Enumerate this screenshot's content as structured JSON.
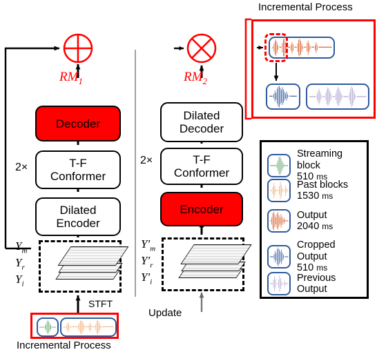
{
  "figure": {
    "left_branch": {
      "sum_operator": "plus-circle",
      "mask_label": "RM",
      "mask_sub": "1",
      "blocks": [
        {
          "id": "decoder",
          "label": "Decoder",
          "fill": "#FF0000"
        },
        {
          "id": "tf-conformer",
          "label": "T-F\nConformer",
          "fill": "#FFFFFF",
          "repeat": "2×"
        },
        {
          "id": "dilated-encoder",
          "label": "Dilated\nEncoder",
          "fill": "#FFFFFF"
        }
      ],
      "spectrogram_labels": [
        "Y_m",
        "Y_r",
        "Y_i"
      ],
      "spectrogram_labels_plain": [
        "Ym",
        "Yr",
        "Yi"
      ],
      "transform_label": "STFT",
      "caption": "Incremental Process"
    },
    "right_branch": {
      "product_operator": "times-circle",
      "mask_label": "RM",
      "mask_sub": "2",
      "blocks": [
        {
          "id": "dilated-decoder",
          "label": "Dilated\nDecoder",
          "fill": "#FFFFFF"
        },
        {
          "id": "tf-conformer-2",
          "label": "T-F\nConformer",
          "fill": "#FFFFFF",
          "repeat": "2×"
        },
        {
          "id": "encoder",
          "label": "Encoder",
          "fill": "#FF0000"
        }
      ],
      "spectrogram_labels": [
        "Y'_m",
        "Y'_r",
        "Y'_i"
      ],
      "spectrogram_labels_plain": [
        "Y'm",
        "Y'r",
        "Y'i"
      ],
      "caption": "Update"
    },
    "incremental_panel": {
      "title": "Incremental Process",
      "items": [
        {
          "name": "past-and-current-output",
          "color": "#D2541E"
        },
        {
          "name": "cropped-output",
          "color": "#2E5A9C"
        },
        {
          "name": "previous-output",
          "color": "#B3A4D4"
        }
      ]
    },
    "legend": {
      "entries": [
        {
          "icon": "waveform-streaming-block-icon",
          "color": "#4E9A5F",
          "name": "Streaming block",
          "duration": "510",
          "unit": "ms"
        },
        {
          "icon": "waveform-past-blocks-icon",
          "color": "#F0A870",
          "name": "Past blocks",
          "duration": "1530",
          "unit": "ms"
        },
        {
          "icon": "waveform-output-icon",
          "color": "#D2541E",
          "name": "Output",
          "duration": "2040",
          "unit": "ms"
        },
        {
          "icon": "waveform-cropped-output-icon",
          "color": "#2E5A9C",
          "name": "Cropped Output",
          "duration": "510",
          "unit": "ms"
        },
        {
          "icon": "waveform-previous-output-icon",
          "color": "#B3A4D4",
          "name": "Previous Output",
          "duration": "",
          "unit": ""
        }
      ]
    },
    "colors": {
      "accent_red": "#FF0000",
      "wave_green": "#4E9A5F",
      "wave_light_orange": "#F0A870",
      "wave_dark_orange": "#D2541E",
      "wave_blue": "#2E5A9C",
      "wave_purple": "#B3A4D4",
      "pill_border": "#2E5A9C"
    }
  }
}
